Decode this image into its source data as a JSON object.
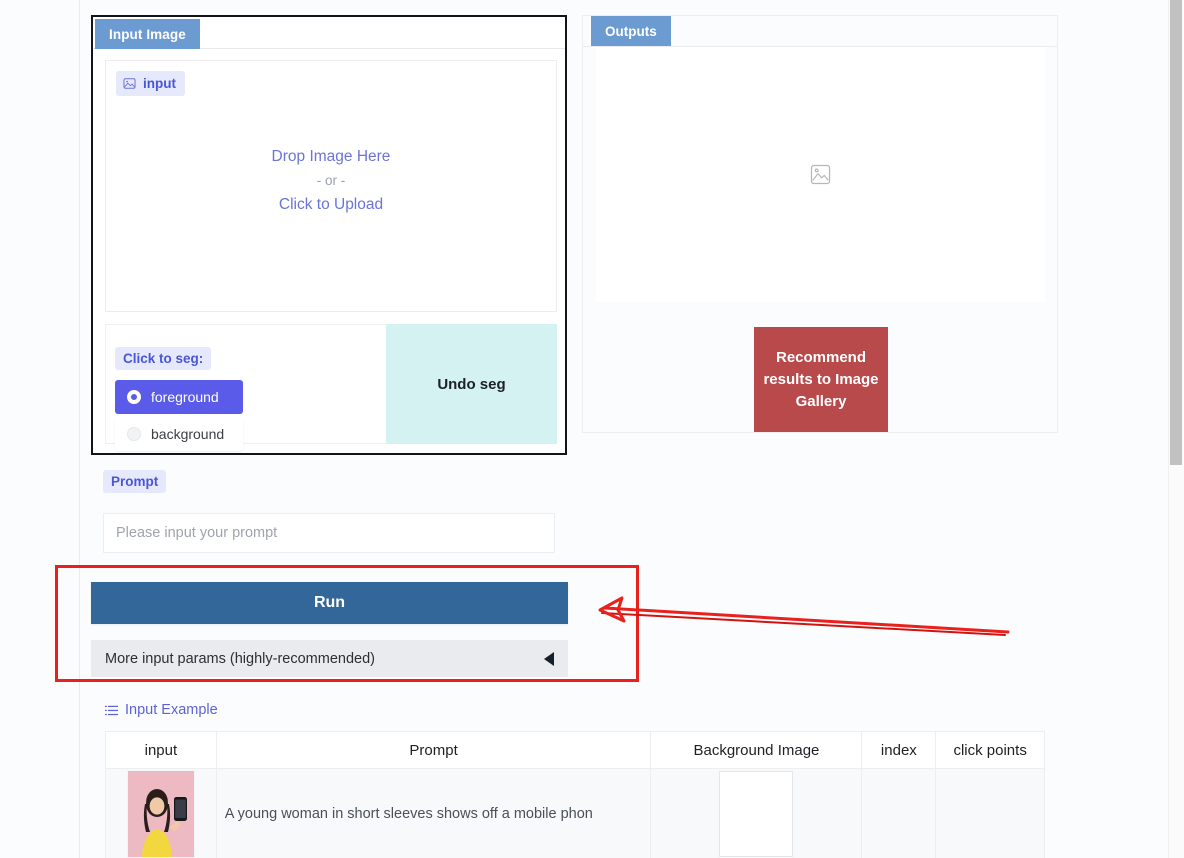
{
  "input_panel": {
    "tab_label": "Input Image",
    "chip_label": "input",
    "chip_icon": "image-icon",
    "dropzone": {
      "line1": "Drop Image Here",
      "line2": "- or -",
      "line3": "Click to Upload"
    },
    "seg": {
      "label": "Click to seg:",
      "options": [
        {
          "label": "foreground",
          "selected": true
        },
        {
          "label": "background",
          "selected": false
        }
      ]
    },
    "undo_label": "Undo seg"
  },
  "outputs_panel": {
    "tab_label": "Outputs",
    "placeholder_icon": "image-placeholder-icon",
    "recommend_label": "Recommend results to Image Gallery"
  },
  "prompt": {
    "label": "Prompt",
    "value": "",
    "placeholder": "Please input your prompt"
  },
  "run": {
    "label": "Run"
  },
  "accordion": {
    "label": "More input params (highly-recommended)",
    "caret_icon": "caret-left-icon",
    "expanded": false
  },
  "example": {
    "heading": "Input Example",
    "heading_icon": "list-icon",
    "columns": [
      "input",
      "Prompt",
      "Background Image",
      "index",
      "click points"
    ],
    "rows": [
      {
        "input": "woman-yellow-top-phone-thumbnail",
        "prompt": "A young woman in short sleeves shows off a mobile phon",
        "background_image": "",
        "index": "",
        "click_points": ""
      }
    ]
  },
  "annotation": {
    "type": "red-highlight-box-with-arrow",
    "color": "#e8211d",
    "target": "Run"
  },
  "scrollbar": {
    "orientation": "vertical",
    "thumb_color": "#c1c1c1"
  },
  "colors": {
    "tab_blue": "#6c9bd2",
    "run_blue": "#336699",
    "chip_indigo": "#4a56d6",
    "radio_selected": "#5b5bea",
    "undo_cyan": "#d4f2f2",
    "recommend_red": "#b84a4c",
    "annotation_red": "#e8211d"
  }
}
